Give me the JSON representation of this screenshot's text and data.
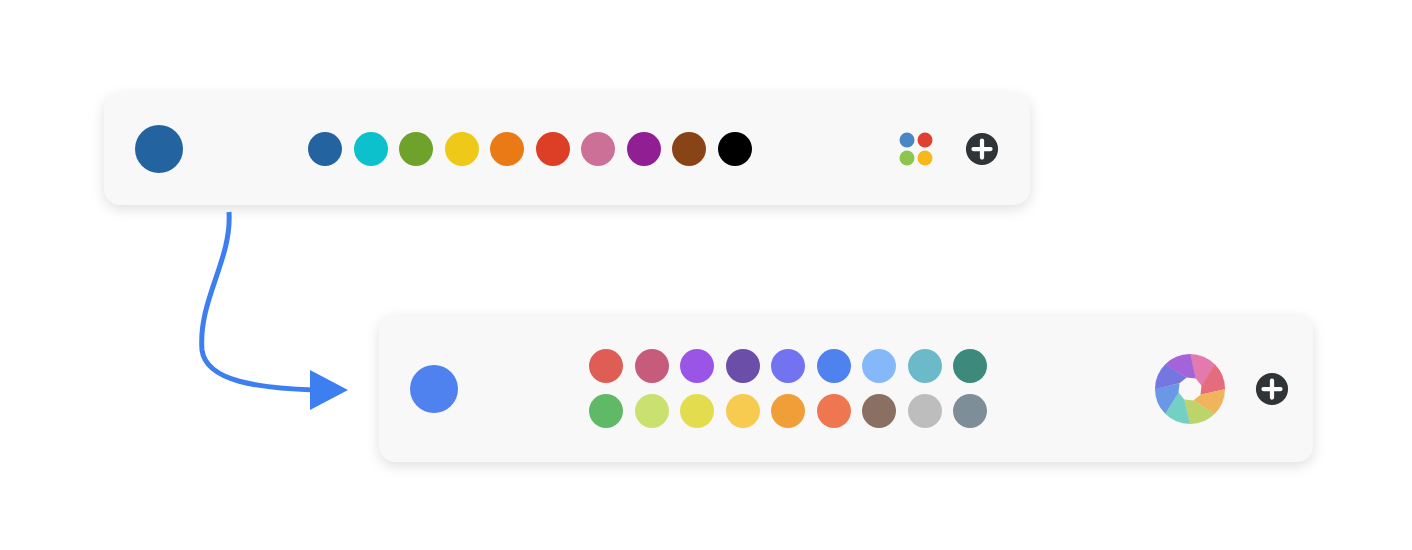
{
  "palettes": [
    {
      "current": {
        "color": "#2364a0"
      },
      "picker": {
        "kind": "dots"
      },
      "rows": [
        [
          {
            "color": "#2364a0"
          },
          {
            "color": "#0cc0cc"
          },
          {
            "color": "#6fa22a"
          },
          {
            "color": "#eec918"
          },
          {
            "color": "#ea7a16"
          },
          {
            "color": "#dc3e26"
          },
          {
            "color": "#cc7098"
          },
          {
            "color": "#921e94"
          },
          {
            "color": "#884416"
          },
          {
            "color": "#000000"
          }
        ]
      ]
    },
    {
      "current": {
        "color": "#4f82ef"
      },
      "picker": {
        "kind": "wheel"
      },
      "rows": [
        [
          {
            "color": "#de5e55"
          },
          {
            "color": "#c75b7b"
          },
          {
            "color": "#9a55e6"
          },
          {
            "color": "#6b4ea7"
          },
          {
            "color": "#7173f0"
          },
          {
            "color": "#4f82ef"
          },
          {
            "color": "#85b8f9"
          },
          {
            "color": "#6cb9c9"
          },
          {
            "color": "#3d897c"
          }
        ],
        [
          {
            "color": "#60b966"
          },
          {
            "color": "#cbe16f"
          },
          {
            "color": "#e3dc4e"
          },
          {
            "color": "#f7cb50"
          },
          {
            "color": "#f09f38"
          },
          {
            "color": "#ee7752"
          },
          {
            "color": "#8a6f63"
          },
          {
            "color": "#bdbdbd"
          },
          {
            "color": "#7e8e99"
          }
        ]
      ]
    }
  ]
}
